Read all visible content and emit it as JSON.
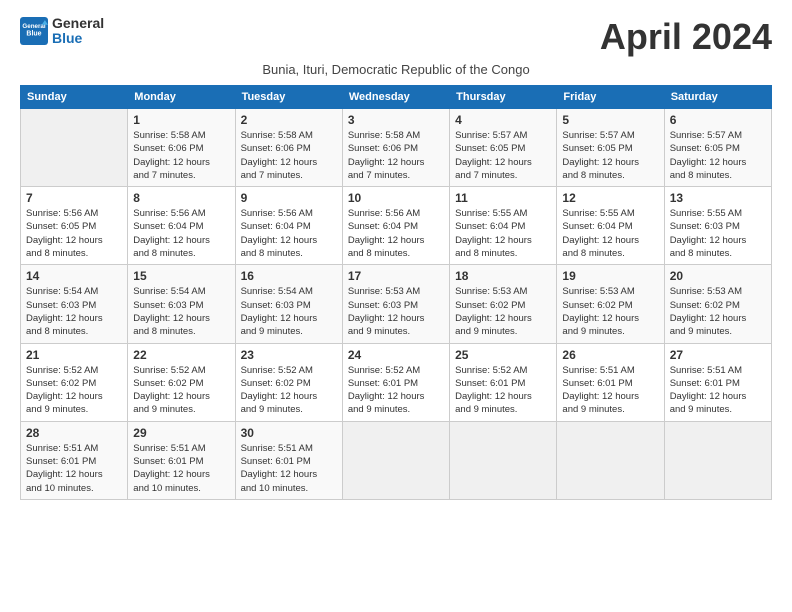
{
  "header": {
    "logo_line1": "General",
    "logo_line2": "Blue",
    "month_title": "April 2024",
    "subtitle": "Bunia, Ituri, Democratic Republic of the Congo"
  },
  "days_of_week": [
    "Sunday",
    "Monday",
    "Tuesday",
    "Wednesday",
    "Thursday",
    "Friday",
    "Saturday"
  ],
  "weeks": [
    [
      {
        "day": "",
        "info": ""
      },
      {
        "day": "1",
        "info": "Sunrise: 5:58 AM\nSunset: 6:06 PM\nDaylight: 12 hours\nand 7 minutes."
      },
      {
        "day": "2",
        "info": "Sunrise: 5:58 AM\nSunset: 6:06 PM\nDaylight: 12 hours\nand 7 minutes."
      },
      {
        "day": "3",
        "info": "Sunrise: 5:58 AM\nSunset: 6:06 PM\nDaylight: 12 hours\nand 7 minutes."
      },
      {
        "day": "4",
        "info": "Sunrise: 5:57 AM\nSunset: 6:05 PM\nDaylight: 12 hours\nand 7 minutes."
      },
      {
        "day": "5",
        "info": "Sunrise: 5:57 AM\nSunset: 6:05 PM\nDaylight: 12 hours\nand 8 minutes."
      },
      {
        "day": "6",
        "info": "Sunrise: 5:57 AM\nSunset: 6:05 PM\nDaylight: 12 hours\nand 8 minutes."
      }
    ],
    [
      {
        "day": "7",
        "info": "Sunrise: 5:56 AM\nSunset: 6:05 PM\nDaylight: 12 hours\nand 8 minutes."
      },
      {
        "day": "8",
        "info": "Sunrise: 5:56 AM\nSunset: 6:04 PM\nDaylight: 12 hours\nand 8 minutes."
      },
      {
        "day": "9",
        "info": "Sunrise: 5:56 AM\nSunset: 6:04 PM\nDaylight: 12 hours\nand 8 minutes."
      },
      {
        "day": "10",
        "info": "Sunrise: 5:56 AM\nSunset: 6:04 PM\nDaylight: 12 hours\nand 8 minutes."
      },
      {
        "day": "11",
        "info": "Sunrise: 5:55 AM\nSunset: 6:04 PM\nDaylight: 12 hours\nand 8 minutes."
      },
      {
        "day": "12",
        "info": "Sunrise: 5:55 AM\nSunset: 6:04 PM\nDaylight: 12 hours\nand 8 minutes."
      },
      {
        "day": "13",
        "info": "Sunrise: 5:55 AM\nSunset: 6:03 PM\nDaylight: 12 hours\nand 8 minutes."
      }
    ],
    [
      {
        "day": "14",
        "info": "Sunrise: 5:54 AM\nSunset: 6:03 PM\nDaylight: 12 hours\nand 8 minutes."
      },
      {
        "day": "15",
        "info": "Sunrise: 5:54 AM\nSunset: 6:03 PM\nDaylight: 12 hours\nand 8 minutes."
      },
      {
        "day": "16",
        "info": "Sunrise: 5:54 AM\nSunset: 6:03 PM\nDaylight: 12 hours\nand 9 minutes."
      },
      {
        "day": "17",
        "info": "Sunrise: 5:53 AM\nSunset: 6:03 PM\nDaylight: 12 hours\nand 9 minutes."
      },
      {
        "day": "18",
        "info": "Sunrise: 5:53 AM\nSunset: 6:02 PM\nDaylight: 12 hours\nand 9 minutes."
      },
      {
        "day": "19",
        "info": "Sunrise: 5:53 AM\nSunset: 6:02 PM\nDaylight: 12 hours\nand 9 minutes."
      },
      {
        "day": "20",
        "info": "Sunrise: 5:53 AM\nSunset: 6:02 PM\nDaylight: 12 hours\nand 9 minutes."
      }
    ],
    [
      {
        "day": "21",
        "info": "Sunrise: 5:52 AM\nSunset: 6:02 PM\nDaylight: 12 hours\nand 9 minutes."
      },
      {
        "day": "22",
        "info": "Sunrise: 5:52 AM\nSunset: 6:02 PM\nDaylight: 12 hours\nand 9 minutes."
      },
      {
        "day": "23",
        "info": "Sunrise: 5:52 AM\nSunset: 6:02 PM\nDaylight: 12 hours\nand 9 minutes."
      },
      {
        "day": "24",
        "info": "Sunrise: 5:52 AM\nSunset: 6:01 PM\nDaylight: 12 hours\nand 9 minutes."
      },
      {
        "day": "25",
        "info": "Sunrise: 5:52 AM\nSunset: 6:01 PM\nDaylight: 12 hours\nand 9 minutes."
      },
      {
        "day": "26",
        "info": "Sunrise: 5:51 AM\nSunset: 6:01 PM\nDaylight: 12 hours\nand 9 minutes."
      },
      {
        "day": "27",
        "info": "Sunrise: 5:51 AM\nSunset: 6:01 PM\nDaylight: 12 hours\nand 9 minutes."
      }
    ],
    [
      {
        "day": "28",
        "info": "Sunrise: 5:51 AM\nSunset: 6:01 PM\nDaylight: 12 hours\nand 10 minutes."
      },
      {
        "day": "29",
        "info": "Sunrise: 5:51 AM\nSunset: 6:01 PM\nDaylight: 12 hours\nand 10 minutes."
      },
      {
        "day": "30",
        "info": "Sunrise: 5:51 AM\nSunset: 6:01 PM\nDaylight: 12 hours\nand 10 minutes."
      },
      {
        "day": "",
        "info": ""
      },
      {
        "day": "",
        "info": ""
      },
      {
        "day": "",
        "info": ""
      },
      {
        "day": "",
        "info": ""
      }
    ]
  ]
}
